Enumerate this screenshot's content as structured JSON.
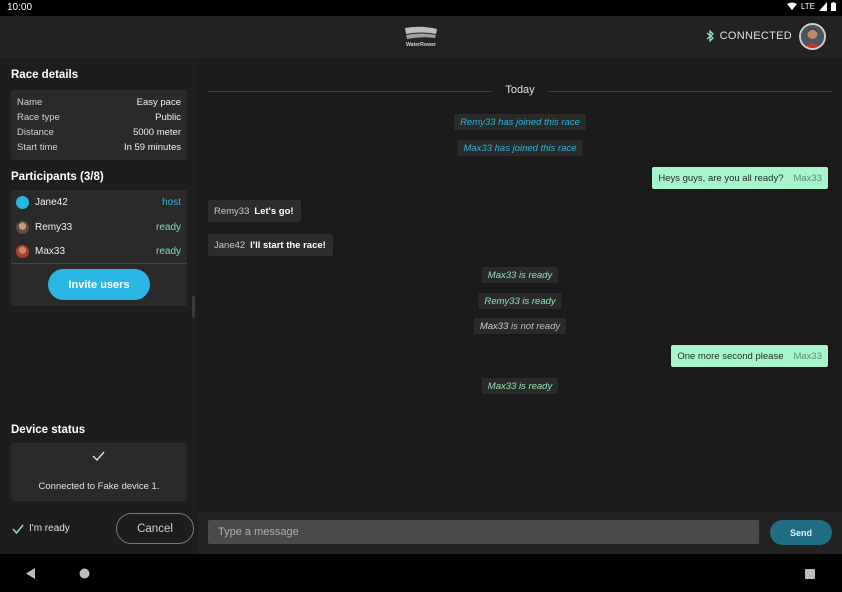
{
  "status_bar": {
    "time": "10:00",
    "network": "LTE"
  },
  "header": {
    "connection_label": "CONNECTED",
    "logo_text": "WaterRower"
  },
  "sidebar": {
    "race_details": {
      "title": "Race details",
      "rows": [
        {
          "key": "Name",
          "value": "Easy pace"
        },
        {
          "key": "Race type",
          "value": "Public"
        },
        {
          "key": "Distance",
          "value": "5000 meter"
        },
        {
          "key": "Start time",
          "value": "In 59 minutes"
        }
      ]
    },
    "participants": {
      "title": "Participants (3/8)",
      "list": [
        {
          "name": "Jane42",
          "status": "host"
        },
        {
          "name": "Remy33",
          "status": "ready"
        },
        {
          "name": "Max33",
          "status": "ready"
        }
      ]
    },
    "invite_label": "Invite users",
    "device_status": {
      "title": "Device status",
      "message": "Connected to Fake device 1."
    },
    "ready_label": "I'm ready",
    "cancel_label": "Cancel"
  },
  "chat": {
    "day_label": "Today",
    "items": [
      {
        "kind": "system",
        "user": "Remy33",
        "text": "has joined this race"
      },
      {
        "kind": "system",
        "user": "Max33",
        "text": "has joined this race"
      },
      {
        "kind": "outgoing",
        "text": "Heys guys, are you all ready?",
        "sender": "Max33"
      },
      {
        "kind": "incoming",
        "sender": "Remy33",
        "text": "Let's go!"
      },
      {
        "kind": "incoming",
        "sender": "Jane42",
        "text": "I'll start the race!"
      },
      {
        "kind": "system",
        "user": "Max33",
        "text": "is ready"
      },
      {
        "kind": "system",
        "user": "Remy33",
        "text": "is ready"
      },
      {
        "kind": "system",
        "user": "Max33",
        "text": "is not ready"
      },
      {
        "kind": "outgoing",
        "text": "One more second please",
        "sender": "Max33"
      },
      {
        "kind": "system",
        "user": "Max33",
        "text": "is ready"
      }
    ]
  },
  "composer": {
    "placeholder": "Type a message",
    "send_label": "Send"
  },
  "colors": {
    "accent": "#29b6e3",
    "outgoing_bubble": "#a8f5cc",
    "ready": "#8bd3c7"
  }
}
